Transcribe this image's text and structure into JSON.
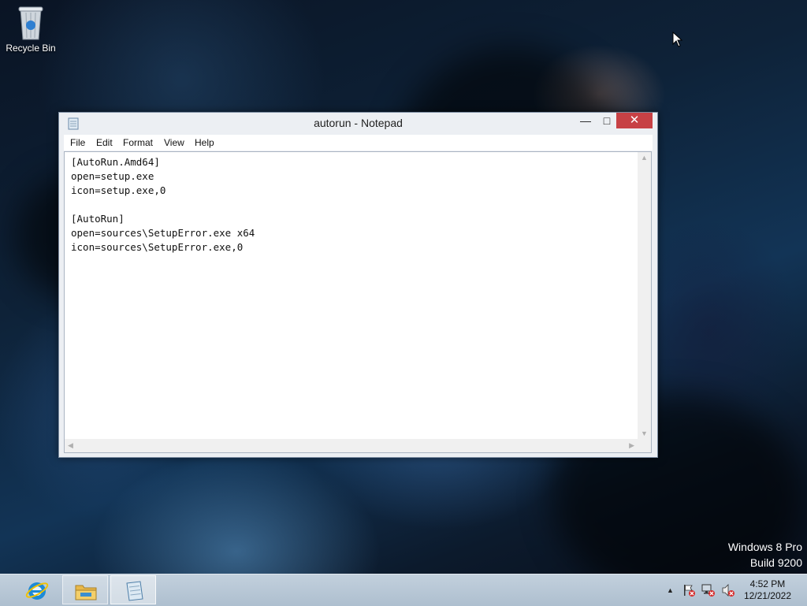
{
  "desktop": {
    "icons": [
      {
        "label": "Recycle Bin",
        "icon": "recycle-bin-icon"
      }
    ],
    "watermark": {
      "edition": "Windows 8 Pro",
      "build": "Build 9200"
    }
  },
  "window": {
    "title": "autorun - Notepad",
    "icon": "notepad-icon",
    "controls": {
      "minimize": "minimize-icon",
      "maximize": "maximize-icon",
      "close": "close-icon"
    },
    "menu": [
      "File",
      "Edit",
      "Format",
      "View",
      "Help"
    ],
    "content": "[AutoRun.Amd64]\nopen=setup.exe\nicon=setup.exe,0\n\n[AutoRun]\nopen=sources\\SetupError.exe x64\nicon=sources\\SetupError.exe,0",
    "close_color": "#c74145"
  },
  "taskbar": {
    "pinned": [
      {
        "name": "Internet Explorer",
        "icon": "internet-explorer-icon"
      },
      {
        "name": "File Explorer",
        "icon": "file-explorer-icon"
      },
      {
        "name": "Notepad",
        "icon": "notepad-icon",
        "active": true
      }
    ],
    "tray": [
      "show-hidden-icons-icon",
      "action-center-flag-icon",
      "network-icon",
      "volume-muted-icon"
    ],
    "clock": {
      "time": "4:52 PM",
      "date": "12/21/2022"
    }
  }
}
